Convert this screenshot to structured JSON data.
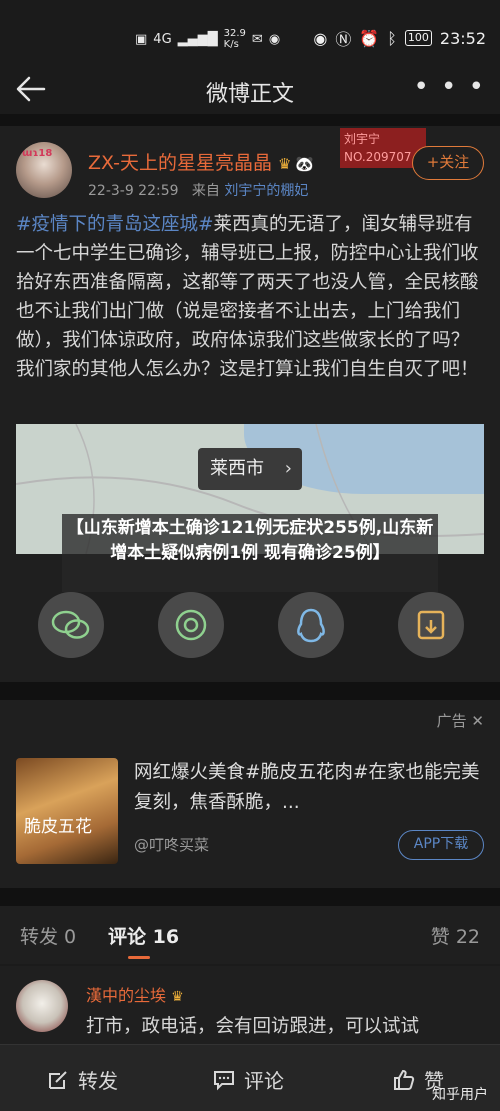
{
  "status_bar": {
    "network": "4G",
    "speed": "32.9",
    "speed_unit": "K/s",
    "battery": "100",
    "time": "23:52"
  },
  "nav": {
    "title": "微博正文",
    "more": "• • •"
  },
  "post": {
    "avatar_tag": "ɯɿ18",
    "author": "ZX-天上的星星亮晶晶",
    "date": "22-3-9 22:59",
    "from_label": "来自",
    "source": "刘宇宁的棚妃",
    "follow_badge_name": "刘宇宁",
    "follow_badge_no": "NO.209707",
    "follow_label": "+关注",
    "topic": "#疫情下的青岛这座城#",
    "text": "莱西真的无语了，闺女辅导班有一个七中学生已确诊，辅导班已上报，防控中心让我们收拾好东西准备隔离，这都等了两天了也没人管，全民核酸也不让我们出门做（说是密接者不让出去，上门给我们做），我们体谅政府，政府体谅我们这些做家长的了吗？我们家的其他人怎么办？这是打算让我们自生自灭了吧！",
    "map_label": "莱西市",
    "map_chevron": "›"
  },
  "overlay_caption": "【山东新增本土确诊121例无症状255例,山东新增本土疑似病例1例 现有确诊25例】",
  "share": {
    "icons": [
      "wechat-icon",
      "moments-icon",
      "qq-icon",
      "save-image-icon"
    ]
  },
  "ad": {
    "label": "广告",
    "image_text": "脆皮五花",
    "title": "网红爆火美食#脆皮五花肉#在家也能完美复刻，焦香酥脆，...",
    "source": "@叮咚买菜",
    "button": "APP下载"
  },
  "tabs": {
    "repost": "转发 0",
    "comments": "评论 16",
    "likes": "赞 22"
  },
  "comment": {
    "name": "漢中的尘埃",
    "text": "打市，政电话，会有回访跟进，可以试试"
  },
  "bottom_bar": {
    "repost": "转发",
    "comment": "评论",
    "like": "赞"
  },
  "watermark": "知乎用户",
  "colors": {
    "accent": "#e86a3a",
    "link": "#5b86c5",
    "background": "#1b1b1b"
  }
}
